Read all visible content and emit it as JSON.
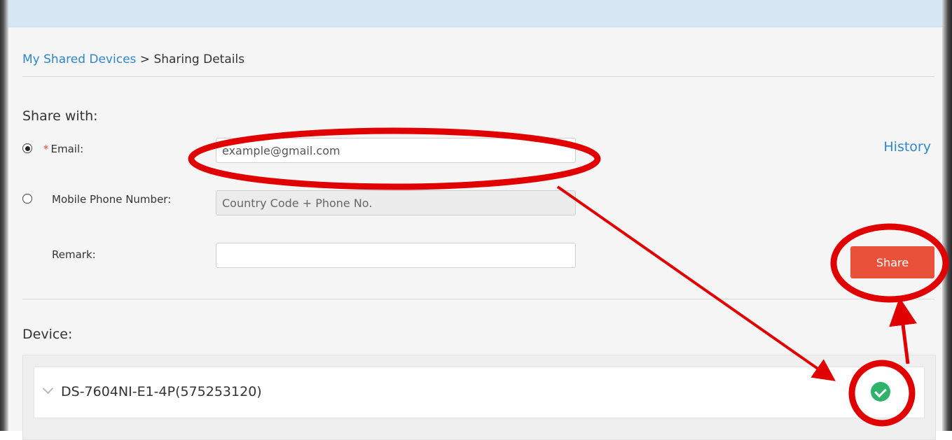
{
  "breadcrumb": {
    "parent": "My Shared Devices",
    "separator": " > ",
    "current": "Sharing Details"
  },
  "share_with": {
    "title": "Share with:",
    "email": {
      "required_mark": "*",
      "label": "Email:",
      "value": "example@gmail.com",
      "selected": true
    },
    "phone": {
      "label": "Mobile Phone Number:",
      "placeholder": "Country Code + Phone No.",
      "selected": false
    },
    "remark": {
      "label": "Remark:",
      "value": ""
    },
    "history_link": "History",
    "share_button": "Share"
  },
  "device_section": {
    "title": "Device:",
    "devices": [
      {
        "name": "DS-7604NI-E1-4P(575253120)",
        "status_icon": "check-circle-icon",
        "selected": true
      }
    ]
  },
  "colors": {
    "link": "#2f87c9",
    "share_button": "#e9513a",
    "check": "#2fb26a",
    "annotation": "#e00000"
  }
}
